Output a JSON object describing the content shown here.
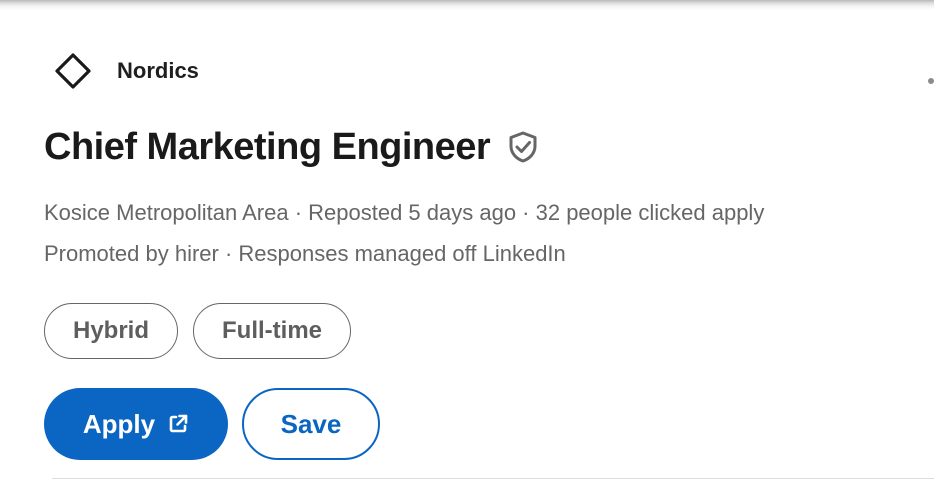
{
  "company": {
    "name": "Nordics",
    "logo_icon": "diamond-outline-icon"
  },
  "job": {
    "title": "Chief Marketing Engineer",
    "verified_icon": "verified-shield-check-icon",
    "meta_line_1": "Kosice Metropolitan Area · Reposted 5 days ago · 32 people clicked apply",
    "meta_line_2": "Promoted by hirer · Responses managed off LinkedIn"
  },
  "chips": [
    {
      "label": "Hybrid"
    },
    {
      "label": "Full-time"
    }
  ],
  "actions": {
    "apply_label": "Apply",
    "apply_icon": "external-link-icon",
    "save_label": "Save"
  },
  "colors": {
    "primary": "#0a66c2",
    "text_secondary": "#666666"
  }
}
